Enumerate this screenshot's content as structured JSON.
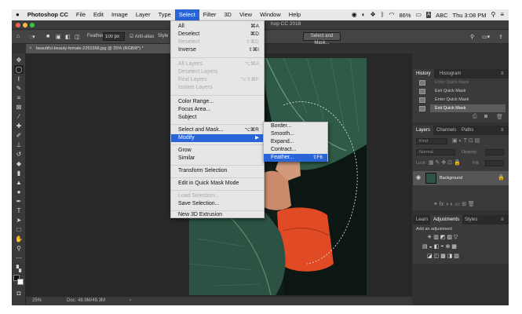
{
  "macbar": {
    "app_name": "Photoshop CC",
    "menus": [
      "File",
      "Edit",
      "Image",
      "Layer",
      "Type",
      "Select",
      "Filter",
      "3D",
      "View",
      "Window",
      "Help"
    ],
    "battery": "86%",
    "input_source": "ABC",
    "clock": "Thu 3:08 PM"
  },
  "window": {
    "title": "hop CC 2018"
  },
  "options": {
    "feather_label": "Feather:",
    "feather_value": "100 px",
    "antialias_label": "Anti-alias",
    "style_label": "Style",
    "select_mask_label": "Select and Mask..."
  },
  "document": {
    "tab_label": "beautiful-beauty-female-2252368.jpg @ 25% (RGB/8*) *"
  },
  "status": {
    "zoom": "25%",
    "doc": "Doc: 48.9M/49.3M"
  },
  "select_menu": {
    "items": [
      {
        "label": "All",
        "shortcut": "⌘A"
      },
      {
        "label": "Deselect",
        "shortcut": "⌘D"
      },
      {
        "label": "Reselect",
        "shortcut": "⇧⌘D"
      },
      {
        "label": "Inverse",
        "shortcut": "⇧⌘I"
      },
      {
        "label": "All Layers",
        "shortcut": "⌥⌘A"
      },
      {
        "label": "Deselect Layers",
        "shortcut": ""
      },
      {
        "label": "Find Layers",
        "shortcut": "⌥⇧⌘F"
      },
      {
        "label": "Isolate Layers",
        "shortcut": ""
      },
      {
        "label": "Color Range...",
        "shortcut": ""
      },
      {
        "label": "Focus Area...",
        "shortcut": ""
      },
      {
        "label": "Subject",
        "shortcut": ""
      },
      {
        "label": "Select and Mask...",
        "shortcut": "⌥⌘R"
      },
      {
        "label": "Modify",
        "shortcut": "▶"
      },
      {
        "label": "Grow",
        "shortcut": ""
      },
      {
        "label": "Similar",
        "shortcut": ""
      },
      {
        "label": "Transform Selection",
        "shortcut": ""
      },
      {
        "label": "Edit in Quick Mask Mode",
        "shortcut": ""
      },
      {
        "label": "Load Selection...",
        "shortcut": ""
      },
      {
        "label": "Save Selection...",
        "shortcut": ""
      },
      {
        "label": "New 3D Extrusion",
        "shortcut": ""
      }
    ]
  },
  "modify_menu": {
    "items": [
      {
        "label": "Border...",
        "shortcut": ""
      },
      {
        "label": "Smooth...",
        "shortcut": ""
      },
      {
        "label": "Expand...",
        "shortcut": ""
      },
      {
        "label": "Contract...",
        "shortcut": ""
      },
      {
        "label": "Feather...",
        "shortcut": "⇧F6"
      }
    ]
  },
  "panels": {
    "history_tabs": [
      "History",
      "Histogram"
    ],
    "history_items": [
      "Enter Quick Mask",
      "Exit Quick Mask",
      "Enter Quick Mask",
      "Exit Quick Mask"
    ],
    "layers_tabs": [
      "Layers",
      "Channels",
      "Paths"
    ],
    "kind_label": "Kind",
    "blend_mode": "Normal",
    "opacity_label": "Opacity:",
    "lock_label": "Lock:",
    "fill_label": "Fill:",
    "layer_name": "Background",
    "adjust_tabs": [
      "Learn",
      "Adjustments",
      "Styles"
    ],
    "add_adjustment": "Add an adjustment"
  },
  "colors": {
    "menu_highlight": "#2a65d7",
    "ui_dark": "#323232"
  }
}
